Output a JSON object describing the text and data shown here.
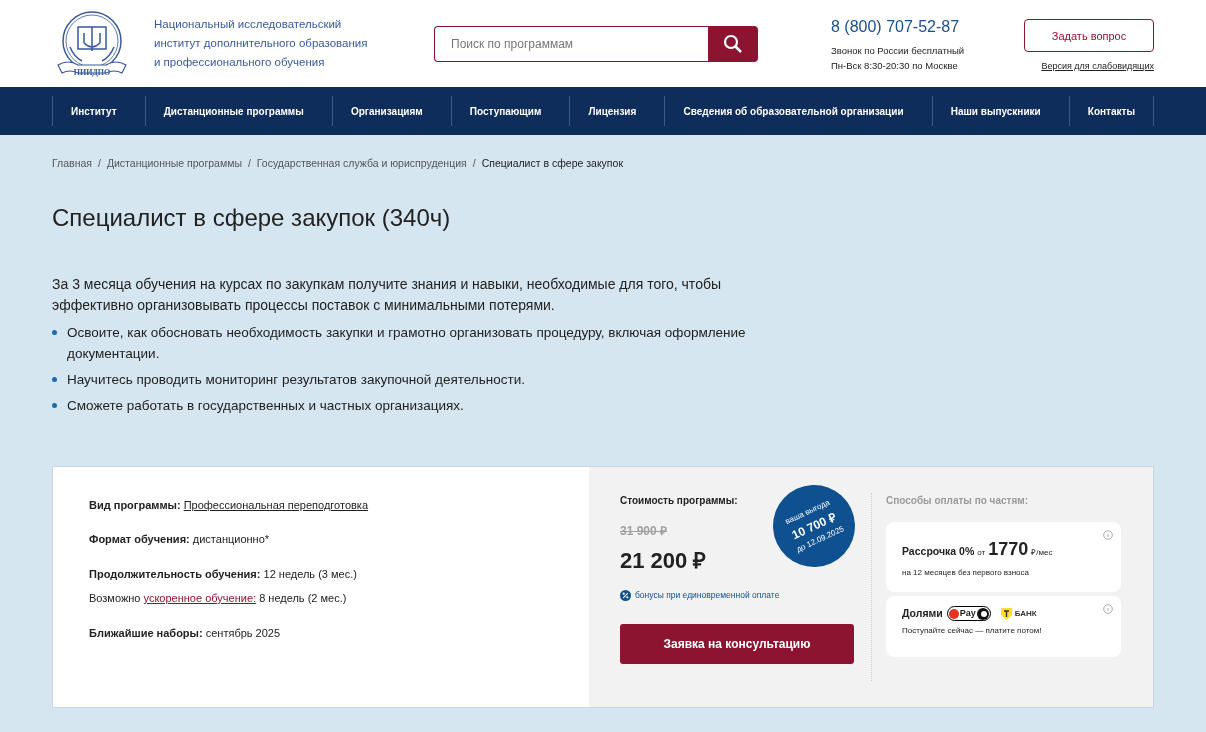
{
  "header": {
    "logo_caption": "НИИДПО",
    "org_name": [
      "Национальный исследовательский",
      "институт дополнительного образования",
      "и профессионального обучения"
    ],
    "search": {
      "placeholder": "Поиск по программам"
    },
    "phone": "8 (800) 707-52-87",
    "phone_notes": [
      "Звонок по России бесплатный",
      "Пн-Вск 8:30-20:30 по Москве"
    ],
    "ask_button": "Задать вопрос",
    "accessibility_link": "Версия для слабовидящих"
  },
  "nav": [
    "Институт",
    "Дистанционные программы",
    "Организациям",
    "Поступающим",
    "Лицензия",
    "Сведения об образовательной организации",
    "Наши выпускники",
    "Контакты"
  ],
  "breadcrumbs": [
    {
      "label": "Главная",
      "current": false
    },
    {
      "separator": "/",
      "label": "Дистанционные программы",
      "current": false
    },
    {
      "separator": "/",
      "label": "Государственная служба и юриспруденция",
      "current": false
    },
    {
      "separator": "/",
      "label": "Специалист в сфере закупок",
      "current": true
    }
  ],
  "title": "Специалист в сфере закупок (340ч)",
  "intro": "За 3 месяца обучения на курсах по закупкам получите знания и навыки, необходимые для того, чтобы эффективно организовывать процессы поставок с минимальными потерями.",
  "bullets": [
    "Освоите, как обосновать необходимость закупки и грамотно организовать процедуру, включая оформление документации.",
    "Научитесь проводить мониторинг результатов закупочной деятельности.",
    "Сможете работать в государственных и частных организациях."
  ],
  "details": [
    {
      "kind": "field",
      "label": "Вид программы:",
      "value": "Профессиональная переподготовка",
      "link": true
    },
    {
      "kind": "field",
      "label": "Формат обучения:",
      "value": "дистанционно*",
      "link": false
    },
    {
      "kind": "field",
      "label": "Продолжительность обучения:",
      "value": "12 недель (3 мес.)",
      "link": false
    },
    {
      "kind": "note",
      "prefix": "Возможно",
      "link_text": "ускоренное обучение:",
      "suffix": "8 недель (2 мес.)"
    },
    {
      "kind": "field",
      "label": "Ближайшие наборы:",
      "value": "сентябрь 2025",
      "link": false
    }
  ],
  "price": {
    "label": "Стоимость программы:",
    "old": "31 900 ₽",
    "current": "21 200 ₽",
    "badge": [
      "ваша выгода",
      "10 700 ₽",
      "до 12.09.2025"
    ],
    "bonus": "бонусы при единовременной оплате",
    "cta": "Заявка на консультацию"
  },
  "installments": {
    "title": "Способы оплаты по частям:",
    "plans": [
      {
        "kind": "credit",
        "name": "Рассрочка 0%",
        "from": "от",
        "amount": "1770",
        "unit": "₽/мес",
        "note": "на 12 месяцев без первого взноса"
      },
      {
        "kind": "split",
        "name": "Долями",
        "pay": "Pay",
        "bank": "БАНК",
        "note": "Поступайте сейчас — платите потом!"
      }
    ]
  }
}
